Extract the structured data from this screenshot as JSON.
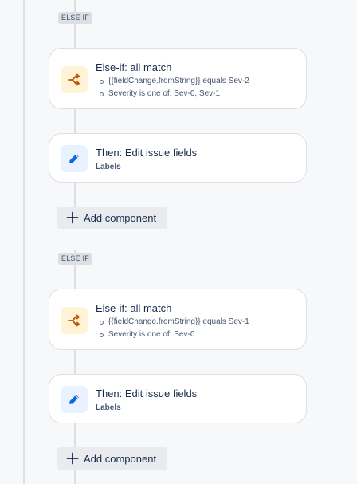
{
  "colors": {
    "rail": "#dcdfe4",
    "branch_icon_bg": "#fff3d6",
    "branch_icon_fg": "#c25100",
    "edit_icon_bg": "#e9f2ff",
    "edit_icon_fg": "#0c66e4"
  },
  "blocks": [
    {
      "tag": "ELSE IF",
      "condition": {
        "icon": "branch-icon",
        "title": "Else-if: all match",
        "items": [
          "{{fieldChange.fromString}} equals Sev-2",
          "Severity is one of: Sev-0, Sev-1"
        ]
      },
      "action": {
        "icon": "pencil-icon",
        "title": "Then: Edit issue fields",
        "subtitle": "Labels"
      },
      "add_label": "Add component"
    },
    {
      "tag": "ELSE IF",
      "condition": {
        "icon": "branch-icon",
        "title": "Else-if: all match",
        "items": [
          "{{fieldChange.fromString}} equals Sev-1",
          "Severity is one of: Sev-0"
        ]
      },
      "action": {
        "icon": "pencil-icon",
        "title": "Then: Edit issue fields",
        "subtitle": "Labels"
      },
      "add_label": "Add component"
    }
  ]
}
